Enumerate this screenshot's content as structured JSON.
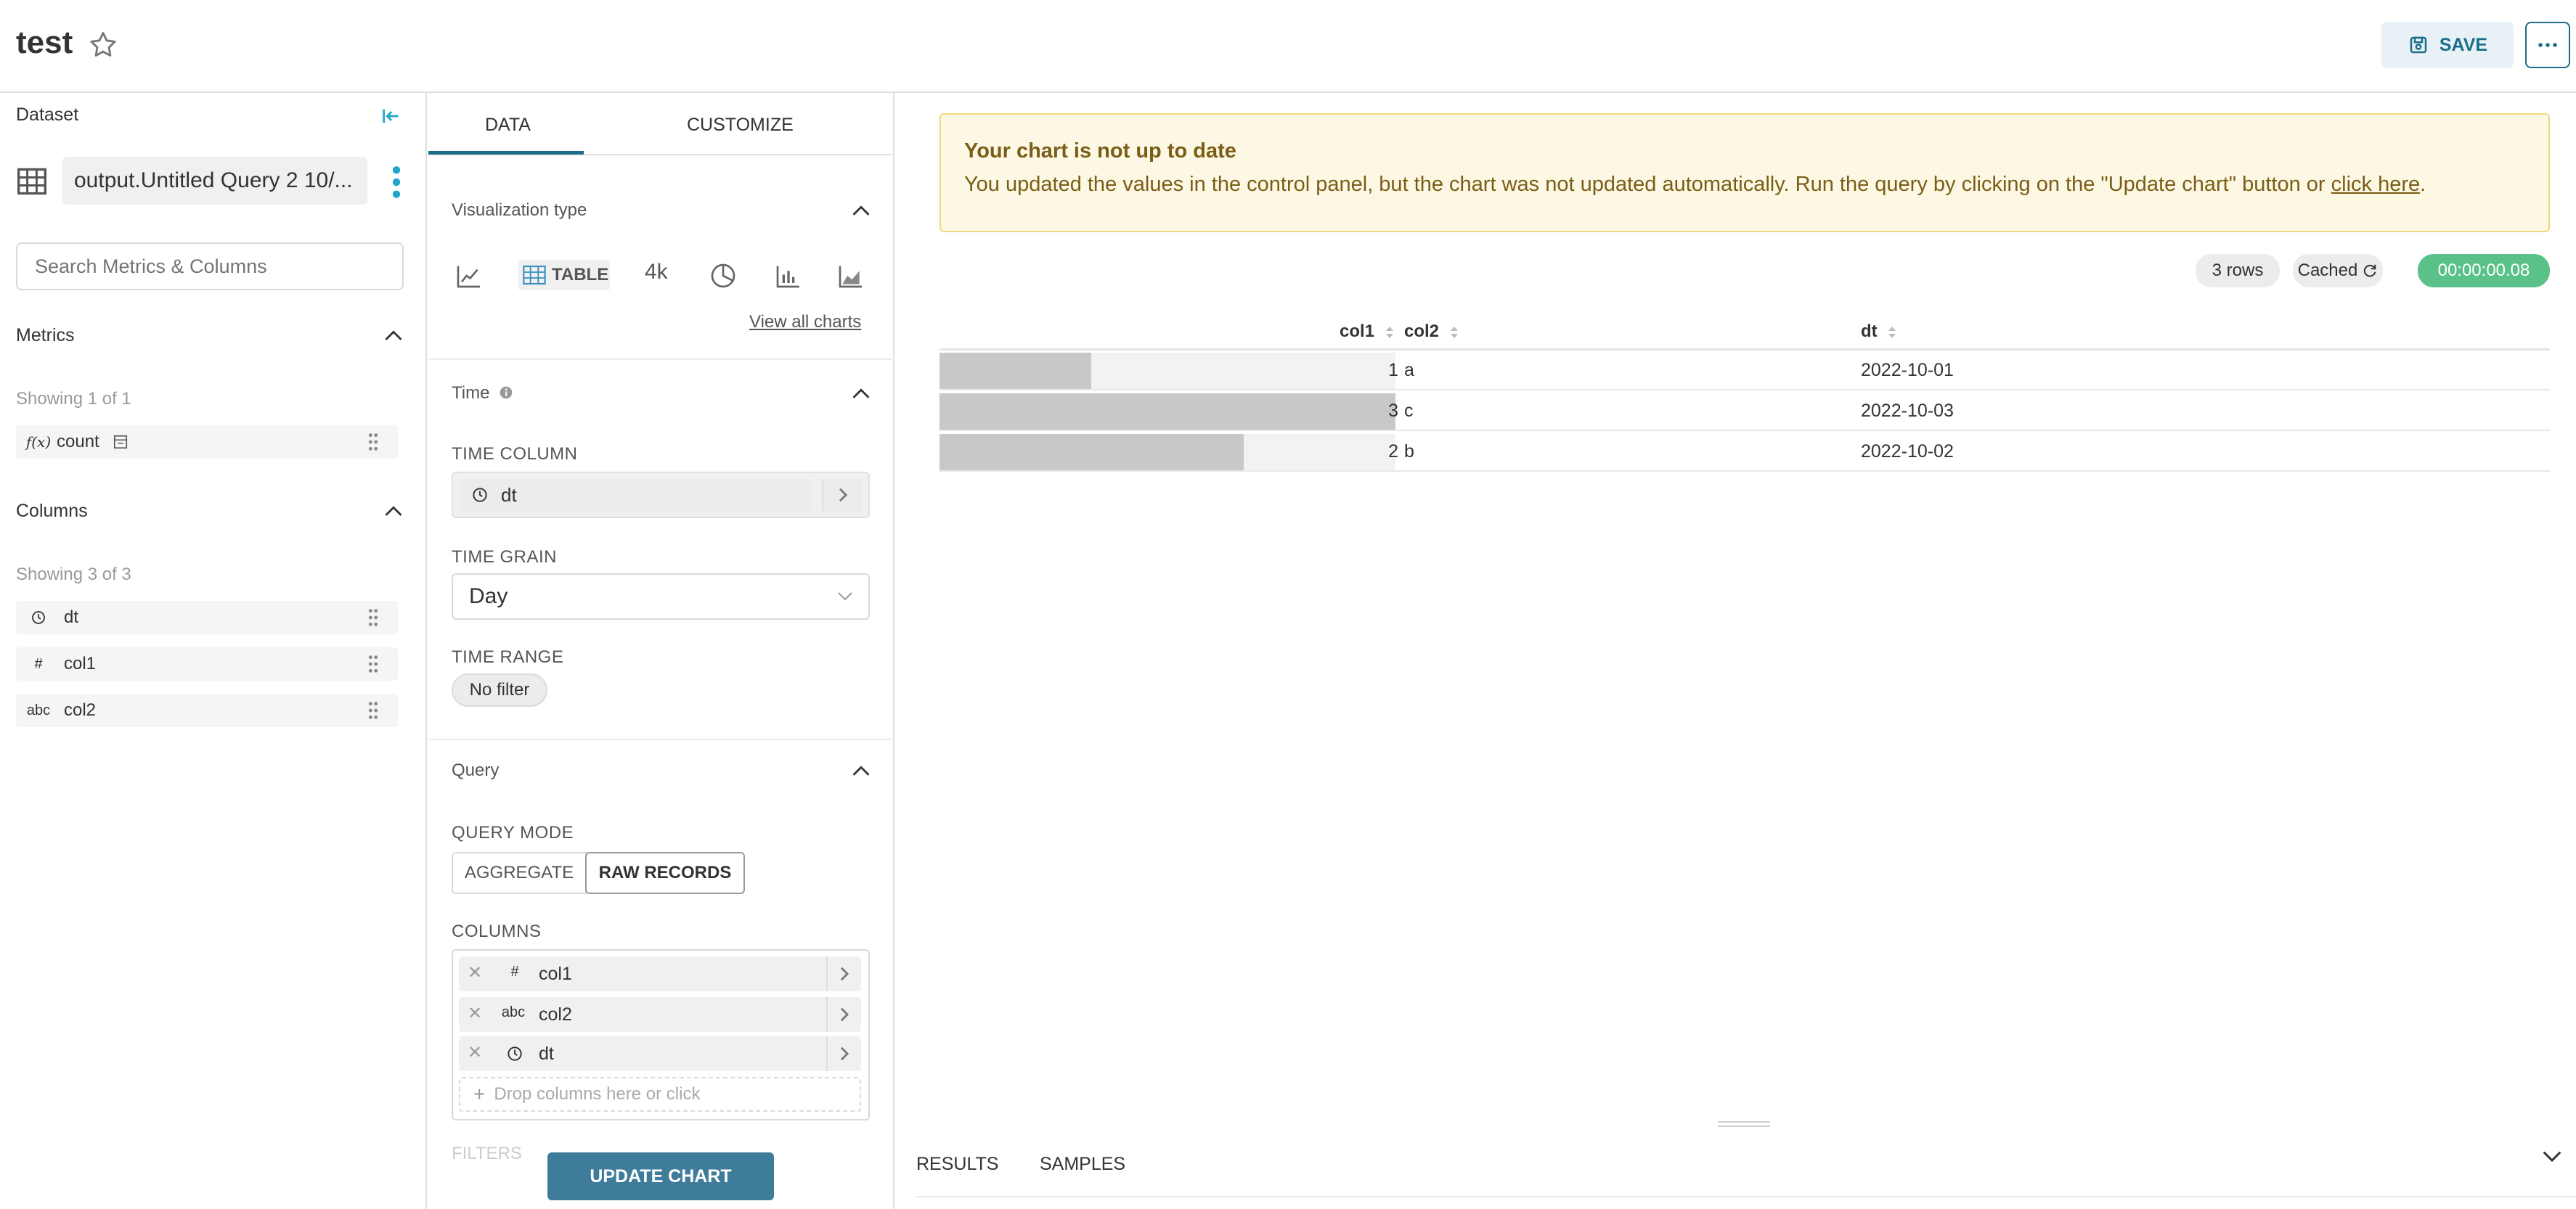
{
  "header": {
    "title": "test",
    "save_label": "SAVE"
  },
  "dataset": {
    "label": "Dataset",
    "name": "output.Untitled Query 2 10/...",
    "search_placeholder": "Search Metrics & Columns",
    "metrics": {
      "title": "Metrics",
      "showing": "Showing 1 of 1",
      "items": [
        {
          "icon": "f(x)",
          "label": "count"
        }
      ]
    },
    "columns": {
      "title": "Columns",
      "showing": "Showing 3 of 3",
      "items": [
        {
          "icon": "clock",
          "label": "dt"
        },
        {
          "icon": "#",
          "label": "col1"
        },
        {
          "icon": "abc",
          "label": "col2"
        }
      ]
    }
  },
  "control": {
    "tabs": [
      "DATA",
      "CUSTOMIZE"
    ],
    "viz": {
      "title": "Visualization type",
      "table_label": "TABLE",
      "bignumber_label": "4k",
      "view_all": "View all charts"
    },
    "time": {
      "title": "Time",
      "time_column_label": "TIME COLUMN",
      "time_column_value": "dt",
      "time_grain_label": "TIME GRAIN",
      "time_grain_value": "Day",
      "time_range_label": "TIME RANGE",
      "time_range_value": "No filter"
    },
    "query": {
      "title": "Query",
      "mode_label": "QUERY MODE",
      "mode_aggregate": "AGGREGATE",
      "mode_raw": "RAW RECORDS",
      "columns_label": "COLUMNS",
      "columns": [
        {
          "icon": "#",
          "label": "col1"
        },
        {
          "icon": "abc",
          "label": "col2"
        },
        {
          "icon": "clock",
          "label": "dt"
        }
      ],
      "drop_placeholder": "Drop columns here or click",
      "filters_label": "FILTERS"
    },
    "update_label": "UPDATE CHART"
  },
  "chart": {
    "alert_title": "Your chart is not up to date",
    "alert_message": "You updated the values in the control panel, but the chart was not updated automatically. Run the query by clicking on the \"Update chart\" button or ",
    "alert_link": "click here",
    "alert_end": ".",
    "rows_badge": "3 rows",
    "cached_badge": "Cached",
    "time_badge": "00:00:00.08",
    "table": {
      "headers": [
        "col1",
        "col2",
        "dt"
      ],
      "rows": [
        {
          "col1": 1,
          "col2": "a",
          "dt": "2022-10-01"
        },
        {
          "col1": 3,
          "col2": "c",
          "dt": "2022-10-03"
        },
        {
          "col1": 2,
          "col2": "b",
          "dt": "2022-10-02"
        }
      ],
      "col1_max": 3
    },
    "bottom_tabs": [
      "RESULTS",
      "SAMPLES"
    ]
  }
}
